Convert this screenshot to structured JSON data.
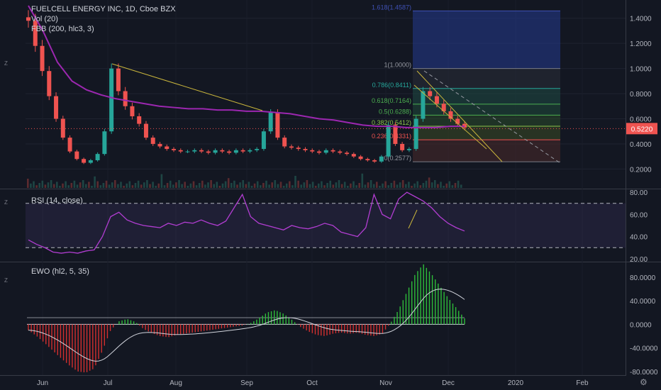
{
  "header": {
    "title": "FUELCELL ENERGY INC, 1D, Cboe BZX",
    "vol_label": "Vol (20)",
    "fbb_label": "FBB (200, hlc3, 3)"
  },
  "rsi_pane": {
    "label": "RSI (14, close)"
  },
  "ewo_pane": {
    "label": "EWO (hl2, 5, 35)"
  },
  "price_badge": "0.5220",
  "colors": {
    "background": "#131722",
    "up": "#26a69a",
    "down": "#ef5350",
    "fbb": "#9c27b0",
    "trendline": "#c9b53c",
    "rsi": "#b13dd1"
  },
  "chart_data": [
    {
      "type": "candlestick",
      "title": "FUELCELL ENERGY INC, 1D, Cboe BZX",
      "x_axis_ticks": [
        "Jun",
        "Jul",
        "Aug",
        "Sep",
        "Oct",
        "Nov",
        "Dec",
        "2020",
        "Feb"
      ],
      "y_axis_ticks": [
        "1.4000",
        "1.2000",
        "1.0000",
        "0.8000",
        "0.6000",
        "0.4000",
        "0.2000"
      ],
      "ylim": [
        0.05,
        1.5
      ],
      "last_price": 0.522,
      "close_series": [
        1.38,
        1.18,
        0.98,
        0.78,
        0.6,
        0.45,
        0.34,
        0.28,
        0.25,
        0.27,
        0.32,
        0.5,
        1.0,
        0.82,
        0.7,
        0.62,
        0.56,
        0.45,
        0.4,
        0.38,
        0.36,
        0.35,
        0.34,
        0.34,
        0.35,
        0.34,
        0.33,
        0.35,
        0.34,
        0.33,
        0.35,
        0.34,
        0.35,
        0.36,
        0.5,
        0.65,
        0.45,
        0.38,
        0.37,
        0.36,
        0.35,
        0.34,
        0.33,
        0.35,
        0.34,
        0.33,
        0.32,
        0.3,
        0.28,
        0.27,
        0.26,
        0.3,
        0.55,
        0.4,
        0.35,
        0.36,
        0.6,
        0.82,
        0.78,
        0.72,
        0.66,
        0.6,
        0.56,
        0.53
      ],
      "fibonacci_levels": [
        {
          "label": "1.618(1.4587)",
          "value": 1.4587
        },
        {
          "label": "1(1.0000)",
          "value": 1.0
        },
        {
          "label": "0.786(0.8411)",
          "value": 0.8411
        },
        {
          "label": "0.618(0.7164)",
          "value": 0.7164
        },
        {
          "label": "0.5(0.6288)",
          "value": 0.6288
        },
        {
          "label": "0.382(0.5412)",
          "value": 0.5412
        },
        {
          "label": "0.236(0.4331)",
          "value": 0.4331
        },
        {
          "label": "0(0.2577)",
          "value": 0.2577
        }
      ],
      "fbb_series": [
        1.5,
        1.3,
        1.05,
        0.9,
        0.83,
        0.79,
        0.76,
        0.74,
        0.72,
        0.7,
        0.69,
        0.68,
        0.68,
        0.67,
        0.67,
        0.66,
        0.66,
        0.65,
        0.64,
        0.62,
        0.6,
        0.59,
        0.57,
        0.55,
        0.54,
        0.54,
        0.53,
        0.53,
        0.53,
        0.54,
        0.54
      ]
    },
    {
      "type": "line",
      "title": "RSI (14, close)",
      "y_axis_ticks": [
        "80.00",
        "60.00",
        "40.00",
        "20.00"
      ],
      "ylim": [
        18,
        82
      ],
      "bands": [
        70,
        30
      ],
      "values": [
        37,
        33,
        30,
        26,
        25,
        26,
        25,
        27,
        28,
        40,
        58,
        62,
        55,
        52,
        50,
        49,
        48,
        52,
        50,
        53,
        52,
        55,
        52,
        50,
        54,
        66,
        78,
        58,
        52,
        50,
        48,
        46,
        50,
        48,
        47,
        49,
        52,
        50,
        44,
        42,
        40,
        48,
        78,
        60,
        56,
        74,
        80,
        76,
        72,
        66,
        58,
        52,
        48,
        45
      ]
    },
    {
      "type": "bar",
      "title": "EWO (hl2, 5, 35)",
      "y_axis_ticks": [
        "80.0000",
        "40.0000",
        "0.0000",
        "-40.0000",
        "-80.0000"
      ],
      "ylim": [
        -85,
        105
      ],
      "values": [
        -10,
        -20,
        -32,
        -45,
        -58,
        -70,
        -80,
        -82,
        -75,
        -45,
        -10,
        5,
        9,
        4,
        -8,
        -15,
        -20,
        -22,
        -18,
        -16,
        -14,
        -12,
        -10,
        -8,
        -6,
        -4,
        -2,
        2,
        10,
        20,
        24,
        18,
        8,
        -4,
        -12,
        -18,
        -20,
        -16,
        -14,
        -16,
        -14,
        -18,
        -20,
        -16,
        2,
        25,
        55,
        85,
        102,
        85,
        65,
        45,
        28,
        10
      ]
    }
  ]
}
